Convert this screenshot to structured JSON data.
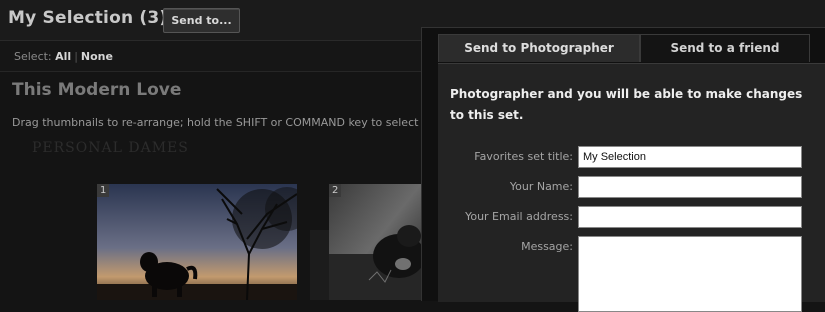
{
  "header": {
    "selection_title": "My Selection (3)",
    "send_button_label": "Send to..."
  },
  "select_bar": {
    "label": "Select:",
    "all_label": "All",
    "none_label": "None"
  },
  "set": {
    "title": "This Modern Love",
    "instructions": "Drag thumbnails to re-arrange; hold the SHIFT or COMMAND key to select m",
    "watermark_text": "PERSONAL   DAMES"
  },
  "thumbnails": [
    {
      "number": "1"
    },
    {
      "number": "2"
    }
  ],
  "modal": {
    "tabs": [
      {
        "label": "Send to Photographer",
        "active": true
      },
      {
        "label": "Send to a friend",
        "active": false
      }
    ],
    "intro": "Photographer and you will be able to make changes to this set.",
    "fields": {
      "title_label": "Favorites set title:",
      "title_value": "My Selection",
      "name_label": "Your Name:",
      "name_value": "",
      "email_label": "Your Email address:",
      "email_value": "",
      "message_label": "Message:",
      "message_value": ""
    }
  },
  "colors": {
    "background": "#141414",
    "panel": "#232323",
    "active_tab": "#2c2c2c"
  }
}
